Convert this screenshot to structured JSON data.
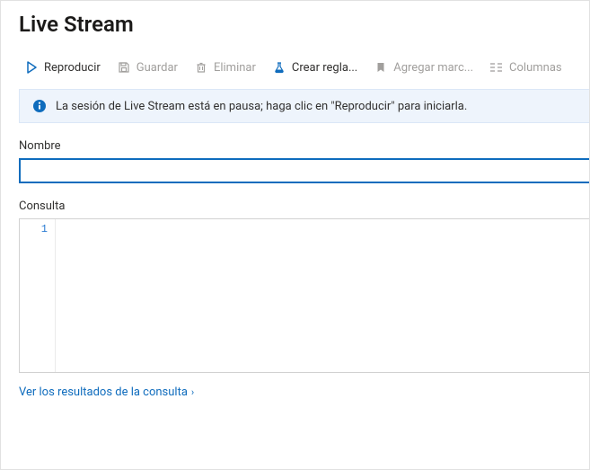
{
  "title": "Live Stream",
  "toolbar": {
    "play": {
      "label": "Reproducir",
      "enabled": true
    },
    "save": {
      "label": "Guardar",
      "enabled": false
    },
    "delete": {
      "label": "Eliminar",
      "enabled": false
    },
    "rule": {
      "label": "Crear regla...",
      "enabled": true
    },
    "bookmark": {
      "label": "Agregar marc...",
      "enabled": false
    },
    "columns": {
      "label": "Columnas",
      "enabled": false
    }
  },
  "banner": {
    "message": "La sesión de Live Stream está en pausa; haga clic en \"Reproducir\" para iniciarla."
  },
  "fields": {
    "name_label": "Nombre",
    "name_value": "",
    "query_label": "Consulta",
    "query_value": "",
    "gutter_start": "1"
  },
  "results_link": "Ver los resultados de la consulta"
}
